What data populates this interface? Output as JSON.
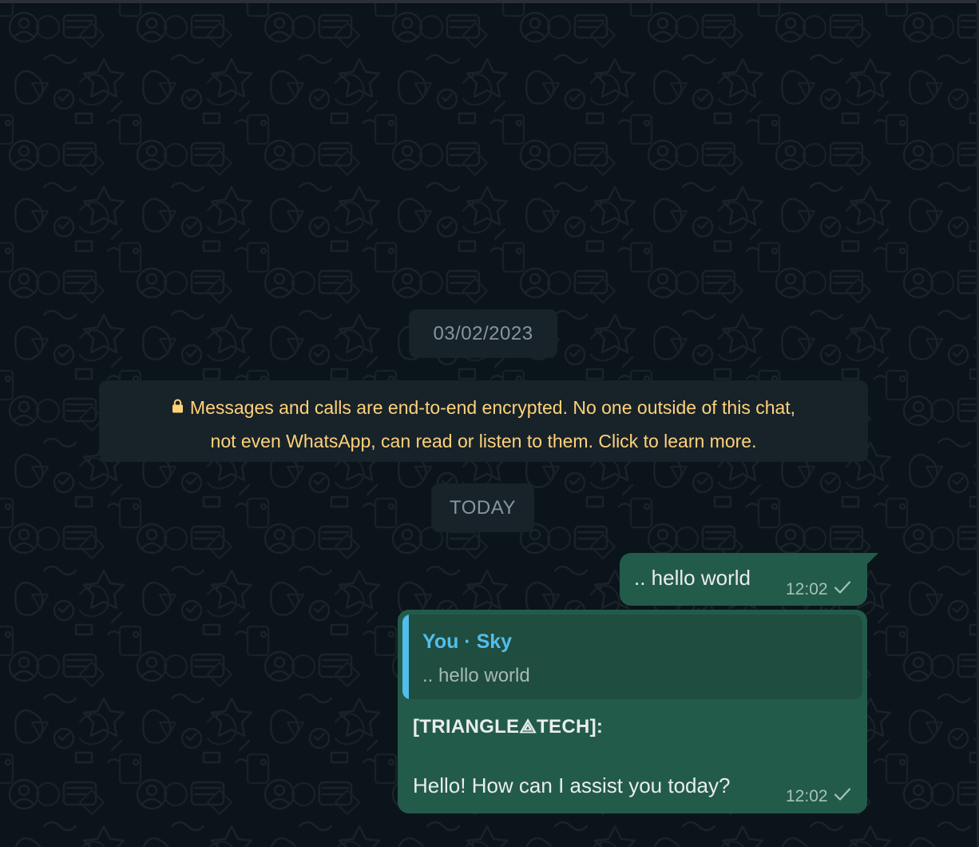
{
  "chat": {
    "date_separator_1": "03/02/2023",
    "encryption_notice_line1": "Messages and calls are end-to-end encrypted. No one outside of this chat,",
    "encryption_notice_line2": "not even WhatsApp, can read or listen to them. Click to learn more.",
    "date_separator_2": "TODAY"
  },
  "messages": [
    {
      "text": ".. hello world",
      "time": "12:02",
      "status_icon": "single-check-icon"
    },
    {
      "quote_author": "You · Sky",
      "quote_text": ".. hello world",
      "bot_tag": "[TRIANGLE⟁TECH]:",
      "text": "Hello! How can I assist you today?",
      "time": "12:02",
      "status_icon": "single-check-icon"
    }
  ],
  "colors": {
    "background": "#0b141a",
    "outgoing_bubble": "#235b4b",
    "system_pill": "#182229",
    "encryption_text": "#ffd279",
    "quote_accent": "#53bdeb"
  }
}
